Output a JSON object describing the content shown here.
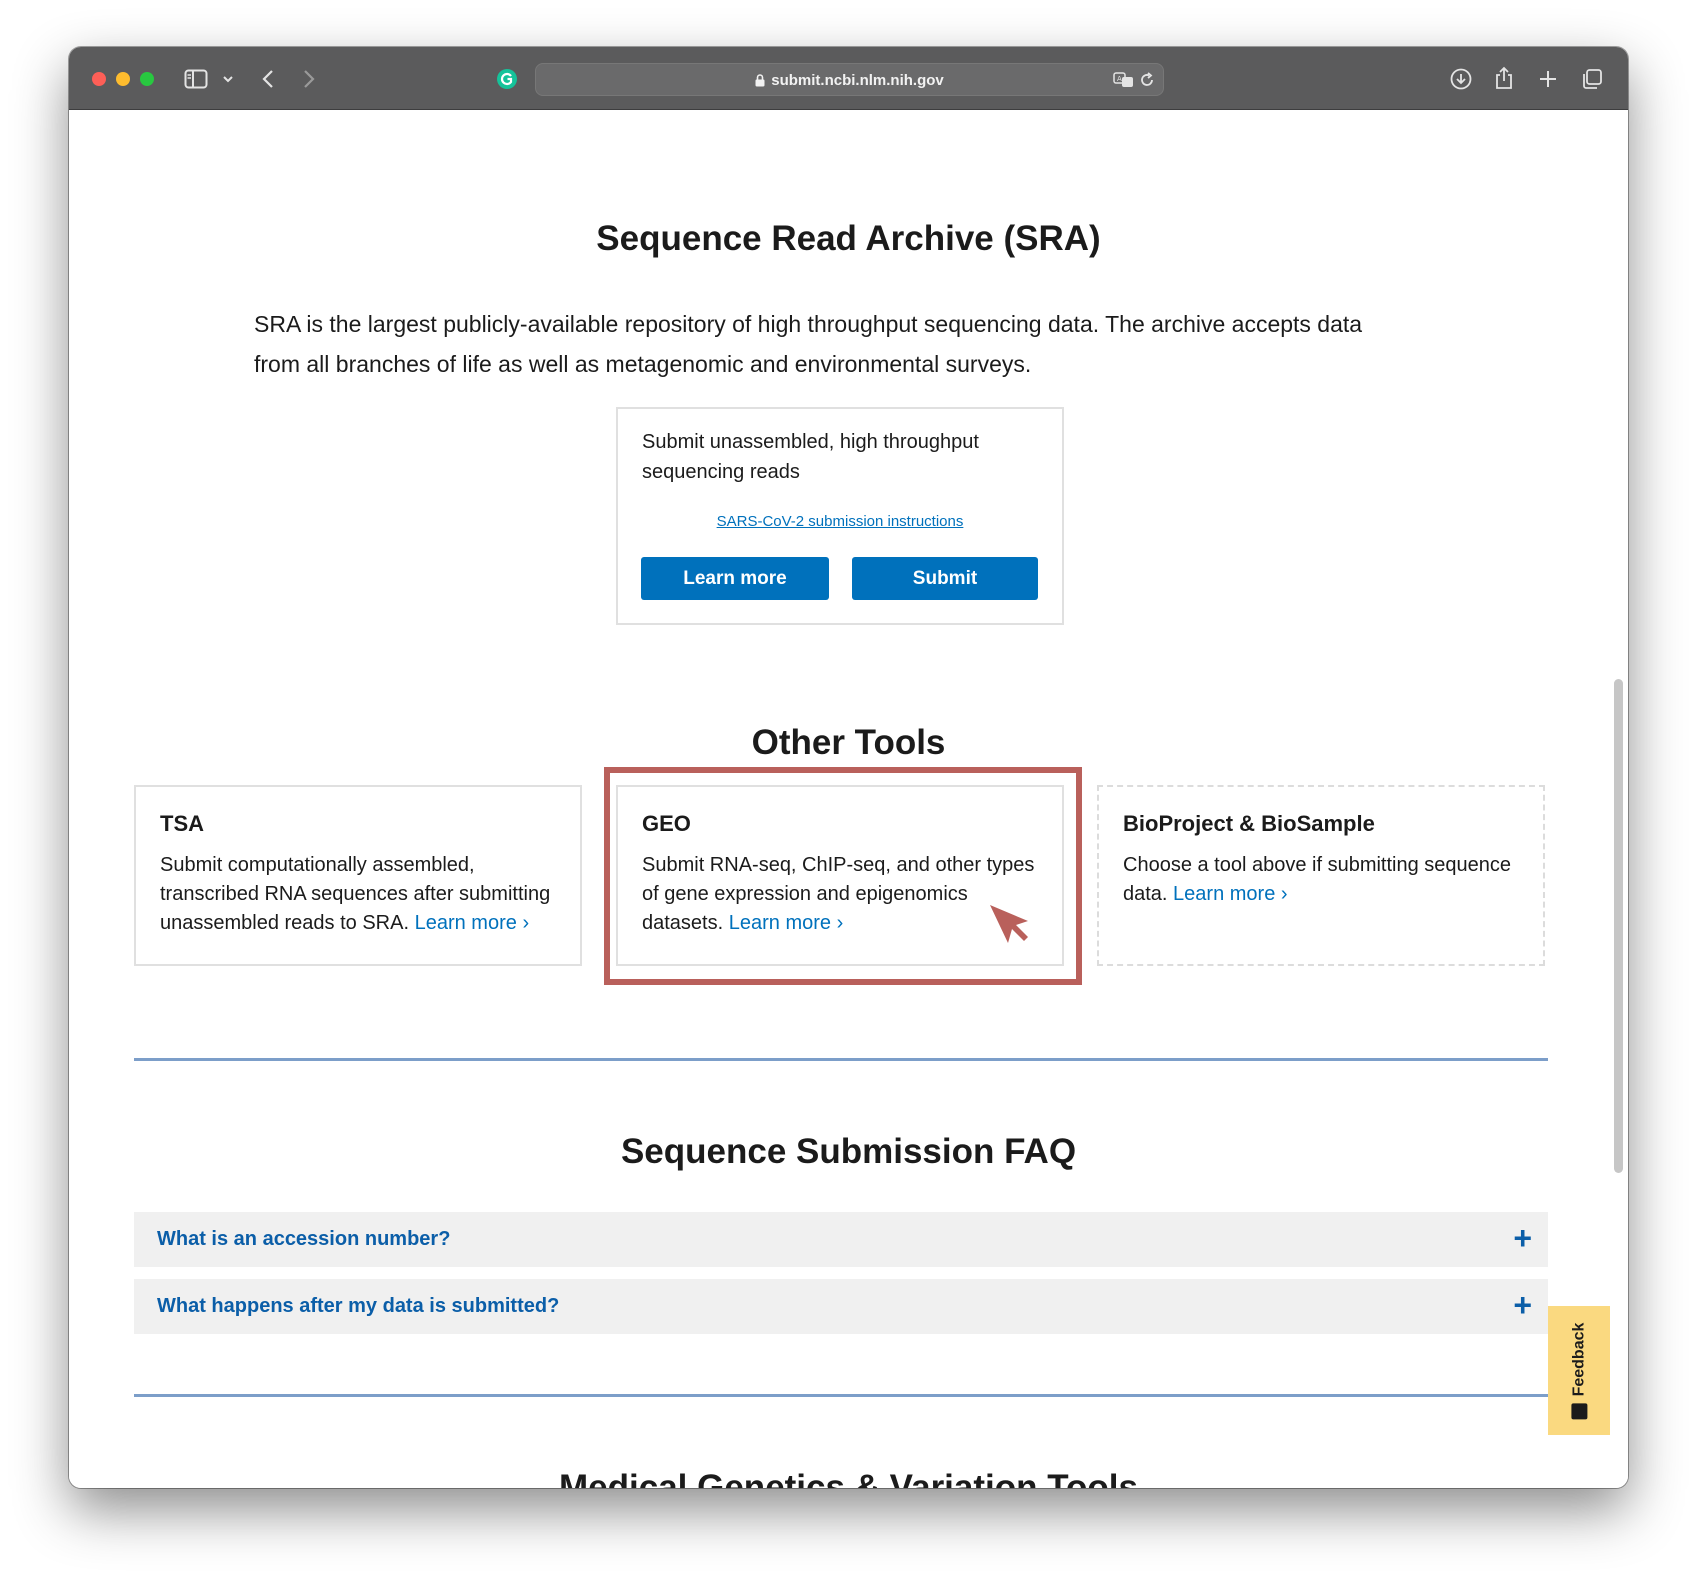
{
  "browser": {
    "url": "submit.ncbi.nlm.nih.gov"
  },
  "sra": {
    "title": "Sequence Read Archive (SRA)",
    "intro_line1": "SRA is the largest publicly-available repository of high throughput sequencing data. The archive accepts data",
    "intro_line2": "from all branches of life as well as metagenomic and environmental surveys.",
    "card_desc": "Submit unassembled, high throughput sequencing reads",
    "covid_link": "SARS-CoV-2 submission instructions",
    "learn_more_button": "Learn more",
    "submit_button": "Submit"
  },
  "other_tools": {
    "title": "Other Tools",
    "cards": [
      {
        "title": "TSA",
        "desc": "Submit computationally assembled, transcribed RNA sequences after submitting unassembled reads to SRA.",
        "link": "Learn more"
      },
      {
        "title": "GEO",
        "desc": "Submit RNA-seq, ChIP-seq, and other types of gene expression and epigenomics datasets.",
        "link": "Learn more"
      },
      {
        "title": "BioProject & BioSample",
        "desc": "Choose a tool above if submitting sequence data.",
        "link": "Learn more"
      }
    ]
  },
  "faq": {
    "title": "Sequence Submission FAQ",
    "items": [
      {
        "question": "What is an accession number?",
        "toggle": "+"
      },
      {
        "question": "What happens after my data is submitted?",
        "toggle": "+"
      }
    ]
  },
  "medgen": {
    "title": "Medical Genetics & Variation Tools"
  },
  "feedback": {
    "label": "Feedback"
  },
  "colors": {
    "link": "#0071bc",
    "button": "#0071bc",
    "faq_text": "#0b5ea8",
    "highlight": "#b9605b",
    "feedback_bg": "#fad980"
  },
  "icons": [
    "sidebar-icon",
    "chevron-down-icon",
    "back-icon",
    "forward-icon",
    "grammarly-icon",
    "lock-icon",
    "translate-icon",
    "reload-icon",
    "download-icon",
    "share-icon",
    "new-tab-icon",
    "tabs-overview-icon",
    "cursor-arrow-icon",
    "plus-icon"
  ]
}
